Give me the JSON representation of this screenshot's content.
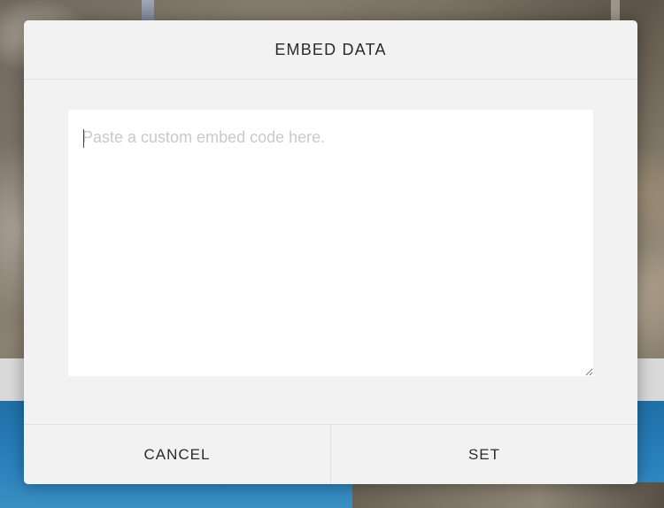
{
  "dialog": {
    "title": "EMBED DATA",
    "textarea": {
      "placeholder": "Paste a custom embed code here.",
      "value": ""
    },
    "buttons": {
      "cancel_label": "CANCEL",
      "set_label": "SET"
    }
  },
  "colors": {
    "dialog_background": "#f2f2f2",
    "textarea_background": "#ffffff",
    "placeholder_text": "#c9c9c9",
    "label_text": "#2b2b2b",
    "divider": "#e0e0e0"
  },
  "icons": {
    "resize_handle": "resize-handle-icon"
  }
}
